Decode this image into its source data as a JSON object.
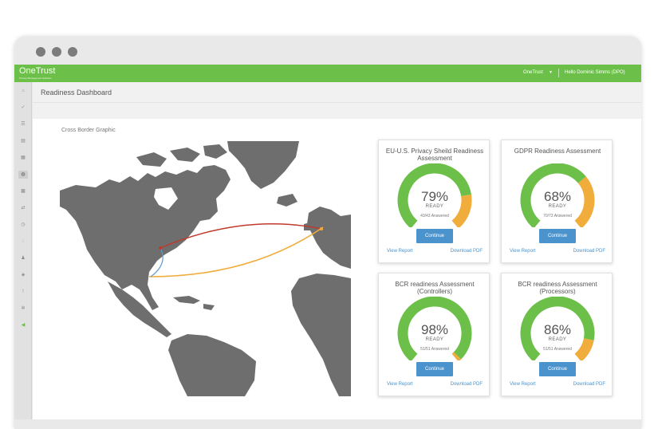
{
  "app": {
    "brand": "OneTrust",
    "brand_subtitle": "Privacy Management Software"
  },
  "header": {
    "org_label": "OneTrust",
    "user_label": "Hello Dominic Simms (DPO)"
  },
  "sidebar": {
    "items": [
      {
        "icon": "home-icon"
      },
      {
        "icon": "check-icon"
      },
      {
        "icon": "list-icon"
      },
      {
        "icon": "inbox-icon"
      },
      {
        "icon": "building-icon"
      },
      {
        "icon": "globe-icon"
      },
      {
        "icon": "grid-icon"
      },
      {
        "icon": "transfer-icon"
      },
      {
        "icon": "clock-icon"
      },
      {
        "icon": "settings-icon"
      },
      {
        "icon": "person-icon"
      },
      {
        "icon": "shield-icon"
      },
      {
        "icon": "alert-icon"
      },
      {
        "icon": "gear-icon"
      },
      {
        "icon": "megaphone-icon"
      }
    ]
  },
  "page": {
    "title": "Readiness Dashboard",
    "section_label": "Cross Border Graphic"
  },
  "map": {
    "land_color": "#6e6e6e",
    "route_colors": [
      "#c0392b",
      "#f0ad3c",
      "#5b9bd5"
    ]
  },
  "cards": [
    {
      "title": "EU-U.S. Privacy Sheild Readiness Assessment",
      "percent_text": "79%",
      "percent_value": 79,
      "ready_label": "READY",
      "answered": "43/43 Answered",
      "button": "Continue",
      "link_left": "View Report",
      "link_right": "Download PDF"
    },
    {
      "title": "GDPR Readiness Assessment",
      "percent_text": "68%",
      "percent_value": 68,
      "ready_label": "READY",
      "answered": "70/73 Answered",
      "button": "Continue",
      "link_left": "View Report",
      "link_right": "Download PDF"
    },
    {
      "title": "BCR readiness Assessment (Controllers)",
      "percent_text": "98%",
      "percent_value": 98,
      "ready_label": "READY",
      "answered": "51/51 Answered",
      "button": "Continue",
      "link_left": "View Report",
      "link_right": "Download PDF"
    },
    {
      "title": "BCR readiness Assessment (Processors)",
      "percent_text": "86%",
      "percent_value": 86,
      "ready_label": "READY",
      "answered": "51/51 Answered",
      "button": "Continue",
      "link_left": "View Report",
      "link_right": "Download PDF"
    }
  ],
  "colors": {
    "brand_green": "#6cc04a",
    "ready_green": "#6cc04a",
    "remaining_orange": "#f0ad3c",
    "button_blue": "#4b93cd"
  }
}
